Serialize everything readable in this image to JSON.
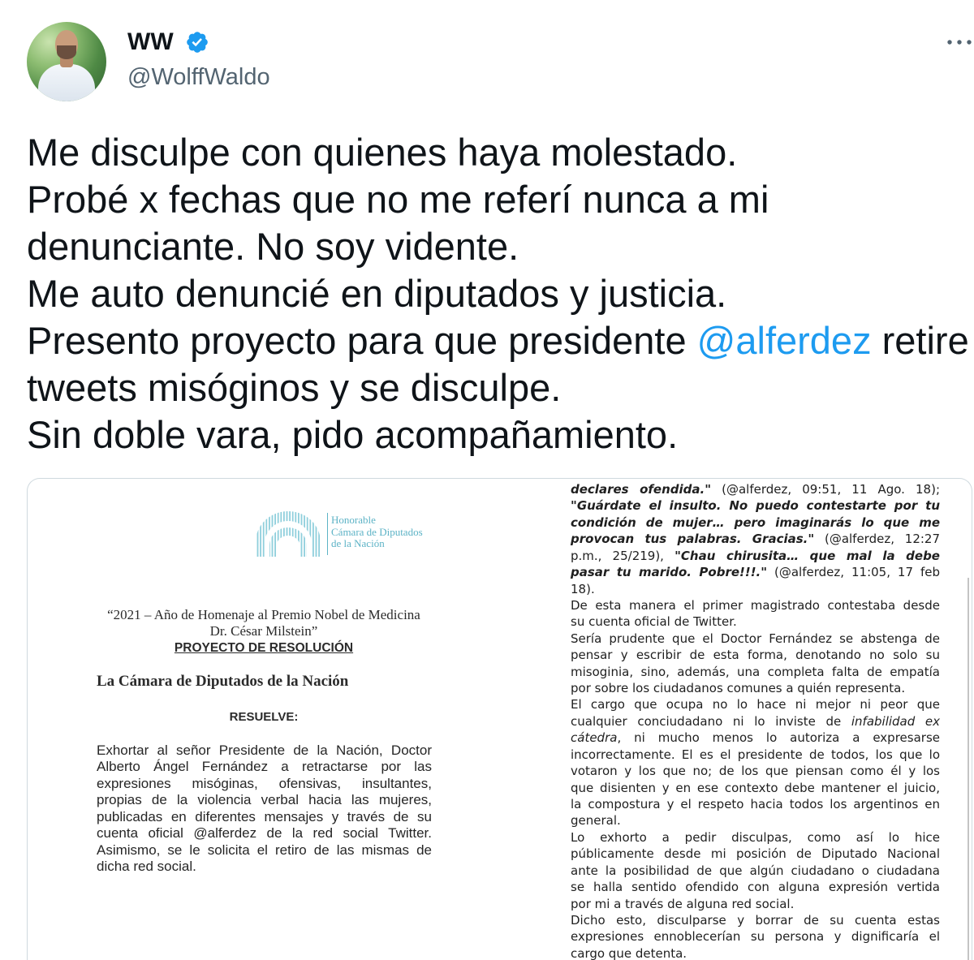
{
  "tweet": {
    "author": {
      "name": "WW",
      "handle": "@WolffWaldo",
      "verified": true
    },
    "text_lines": [
      [
        {
          "text": "Me disculpe con quienes haya molestado."
        }
      ],
      [
        {
          "text": "Probé x fechas que no me referí nunca a mi"
        }
      ],
      [
        {
          "text": "denunciante. No soy vidente."
        }
      ],
      [
        {
          "text": "Me auto denuncié en diputados y justicia."
        }
      ],
      [
        {
          "text": "Presento proyecto para que presidente "
        },
        {
          "text": "@alferdez",
          "mention": true
        },
        {
          "text": " retire"
        }
      ],
      [
        {
          "text": "tweets misóginos y se disculpe."
        }
      ],
      [
        {
          "text": "Sin doble vara, pido acompañamiento."
        }
      ]
    ]
  },
  "icons": {
    "verified": "verified-badge-icon",
    "more": "more-dots-icon",
    "logo": "diputados-logo-icon"
  },
  "colors": {
    "text": "#0f1419",
    "secondary": "#536471",
    "accent": "#1d9bf0",
    "border": "#cfd9de",
    "logo": "#5db3c6"
  },
  "media": {
    "left_page": {
      "logo_text": [
        "Honorable",
        "Cámara de Diputados",
        "de la Nación"
      ],
      "header_lines": [
        "“2021 – Año de Homenaje al Premio Nobel de Medicina",
        "Dr. César Milstein”"
      ],
      "doc_type": "PROYECTO DE RESOLUCIÓN",
      "chamber": "La Cámara de Diputados de la Nación",
      "verb": "RESUELVE:",
      "body_lines": [
        "Exhortar al señor Presidente de la Nación, Doctor",
        "Alberto Ángel Fernández a retractarse por las",
        "expresiones misóginas, ofensivas, insultantes,",
        "propias de la violencia verbal hacia las mujeres,",
        "publicadas en diferentes mensajes y través de su",
        "cuenta oficial @alferdez de la red social Twitter.",
        "Asimismo, se le solicita el retiro de las mismas de",
        "dicha red social."
      ]
    },
    "right_page": {
      "paragraphs": [
        [
          [
            {
              "text": "declares ofendida.\"",
              "emphasis": "bold-italic"
            },
            {
              "text": " (@alferdez, 09:51, 11 Ago. 18);"
            }
          ],
          [
            {
              "text": "\"Guárdate el insulto. No puedo contestarte por tu",
              "emphasis": "bold-italic"
            }
          ],
          [
            {
              "text": "condición de mujer… pero imaginarás lo que me",
              "emphasis": "bold-italic"
            }
          ],
          [
            {
              "text": "provocan tus palabras. Gracias.\"",
              "emphasis": "bold-italic"
            },
            {
              "text": " (@alferdez, 12:27"
            }
          ],
          [
            {
              "text": "p.m., 25/219), "
            },
            {
              "text": "\"Chau chirusita… que mal la debe",
              "emphasis": "bold-italic"
            }
          ],
          [
            {
              "text": "pasar tu marido. Pobre!!!.\"",
              "emphasis": "bold-italic"
            },
            {
              "text": " (@alferdez, 11:05, 17 feb"
            }
          ],
          [
            {
              "text": "18)."
            }
          ]
        ],
        [
          [
            {
              "text": "De esta manera el primer magistrado contestaba desde"
            }
          ],
          [
            {
              "text": "su cuenta oficial de Twitter."
            }
          ]
        ],
        [
          [
            {
              "text": "Sería prudente que el Doctor Fernández se abstenga de"
            }
          ],
          [
            {
              "text": "pensar y escribir de esta forma, denotando no solo su"
            }
          ],
          [
            {
              "text": "misoginia, sino, además, una completa falta de empatía"
            }
          ],
          [
            {
              "text": "por sobre los ciudadanos comunes a quién representa."
            }
          ]
        ],
        [
          [
            {
              "text": "El cargo que ocupa no lo hace ni mejor ni peor que"
            }
          ],
          [
            {
              "text": "cualquier conciudadano ni lo inviste de "
            },
            {
              "text": "infabilidad ex",
              "emphasis": "italic"
            }
          ],
          [
            {
              "text": "cátedra",
              "emphasis": "italic"
            },
            {
              "text": ", ni mucho menos lo autoriza a expresarse"
            }
          ],
          [
            {
              "text": "incorrectamente. El es el presidente de todos, los que lo"
            }
          ],
          [
            {
              "text": "votaron y los que no; de los que piensan como él y los"
            }
          ],
          [
            {
              "text": "que disienten y en ese contexto debe mantener el juicio,"
            }
          ],
          [
            {
              "text": "la compostura y el respeto hacia todos los argentinos en"
            }
          ],
          [
            {
              "text": "general."
            }
          ]
        ],
        [
          [
            {
              "text": "Lo exhorto a pedir disculpas, como así lo hice"
            }
          ],
          [
            {
              "text": "públicamente desde mi posición de Diputado Nacional"
            }
          ],
          [
            {
              "text": "ante la posibilidad de que algún ciudadano o ciudadana"
            }
          ],
          [
            {
              "text": "se halla sentido ofendido con alguna expresión vertida"
            }
          ],
          [
            {
              "text": "por mi a través de alguna red social."
            }
          ]
        ],
        [
          [
            {
              "text": "Dicho esto, disculparse y borrar de su cuenta estas"
            }
          ],
          [
            {
              "text": "expresiones ennoblecerían su persona y dignificaría el"
            }
          ],
          [
            {
              "text": "cargo que detenta."
            }
          ]
        ]
      ]
    }
  }
}
